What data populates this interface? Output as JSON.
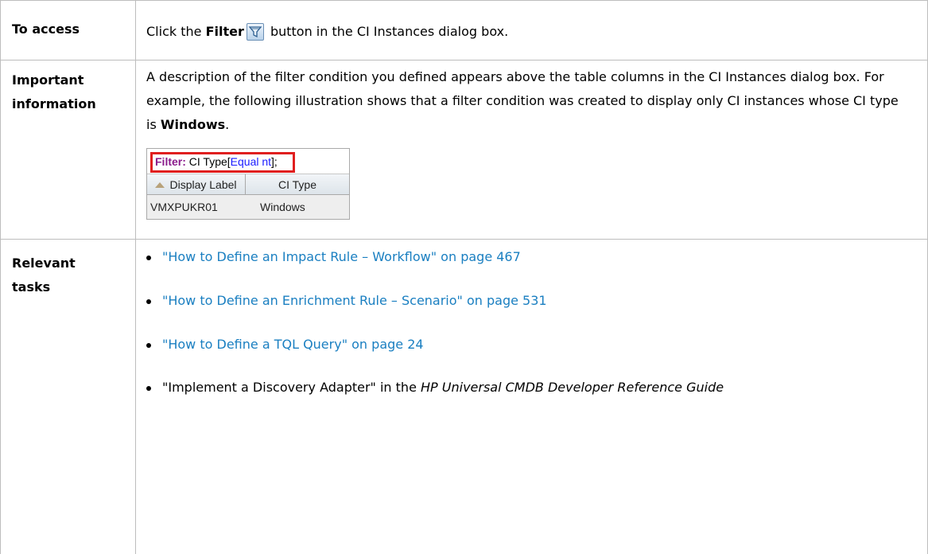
{
  "rows": {
    "access": {
      "label": "To access",
      "before": "Click the ",
      "bold": "Filter",
      "after": " button in the CI Instances dialog box.",
      "icon": "filter-icon"
    },
    "important": {
      "label_line1": "Important",
      "label_line2": "information",
      "text": "A description of the filter condition you defined appears above the table columns in the CI Instances dialog box. For example, the following illustration shows that a filter condition was created to display only CI instances whose CI type is ",
      "bold": "Windows",
      "end": "."
    },
    "tasks": {
      "label_line1": "Relevant",
      "label_line2": "tasks"
    }
  },
  "illustration": {
    "filter_label": "Filter:",
    "filter_text_1": " CI Type[",
    "filter_op": "Equal nt",
    "filter_text_2": "];",
    "col1": "Display Label",
    "col2": "CI Type",
    "row_cell1": "VMXPUKR01",
    "row_cell2": "Windows"
  },
  "tasks": [
    {
      "link": "\"How to Define an Impact Rule – Workflow\" on page 467"
    },
    {
      "link": "\"How to Define an Enrichment Rule – Scenario\" on page 531"
    },
    {
      "link": "\"How to Define a TQL Query\" on page 24"
    }
  ],
  "last_task": {
    "text": "\"Implement a Discovery Adapter\" in the ",
    "italic": "HP Universal CMDB Developer Reference Guide"
  },
  "colors": {
    "link": "#1a7fc1",
    "highlight_box": "#e01f1f",
    "border": "#bdbdbd"
  }
}
